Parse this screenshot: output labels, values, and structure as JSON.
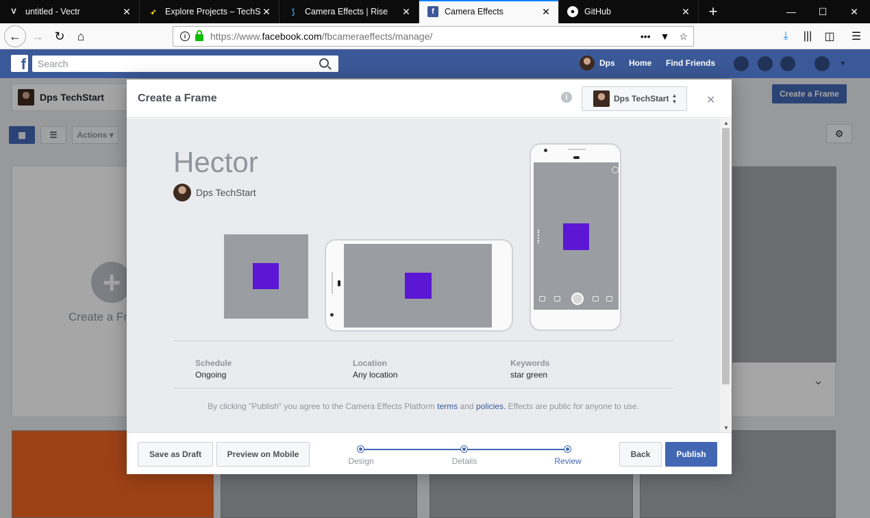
{
  "browser": {
    "tabs": [
      {
        "title": "untitled - Vectr",
        "icon": "vectr-icon",
        "active": false
      },
      {
        "title": "Explore Projects – TechStart",
        "icon": "rocket-icon",
        "active": false
      },
      {
        "title": "Camera Effects | Rise",
        "icon": "rise-icon",
        "active": false
      },
      {
        "title": "Camera Effects",
        "icon": "facebook-icon",
        "active": true
      },
      {
        "title": "GitHub",
        "icon": "github-icon",
        "active": false
      }
    ],
    "url_prefix": "https://www.",
    "url_domain": "facebook.com",
    "url_path": "/fbcameraeffects/manage/"
  },
  "fb": {
    "search_placeholder": "Search",
    "user_name": "Dps",
    "nav_home": "Home",
    "nav_find_friends": "Find Friends",
    "page_name": "Dps TechStart",
    "create_frame_button": "Create a Frame",
    "actions_label": "Actions",
    "create_card_label": "Create a Frame"
  },
  "modal": {
    "title": "Create a Frame",
    "page_selector": "Dps TechStart",
    "frame_name": "Hector",
    "owner_name": "Dps TechStart",
    "summary": [
      {
        "label": "Schedule",
        "value": "Ongoing"
      },
      {
        "label": "Location",
        "value": "Any location"
      },
      {
        "label": "Keywords",
        "value": "star green"
      }
    ],
    "legal_prefix": "By clicking \"Publish\" you agree to the Camera Effects Platform ",
    "legal_terms": "terms",
    "legal_and": " and ",
    "legal_policies": "policies.",
    "legal_suffix": " Effects are public for anyone to use.",
    "buttons": {
      "save_draft": "Save as Draft",
      "preview_mobile": "Preview on Mobile",
      "back": "Back",
      "publish": "Publish"
    },
    "steps": [
      "Design",
      "Details",
      "Review"
    ],
    "current_step": "Review"
  },
  "colors": {
    "fb_blue": "#3b5998",
    "primary": "#4267b2",
    "frame_purple": "#5b17d4"
  }
}
